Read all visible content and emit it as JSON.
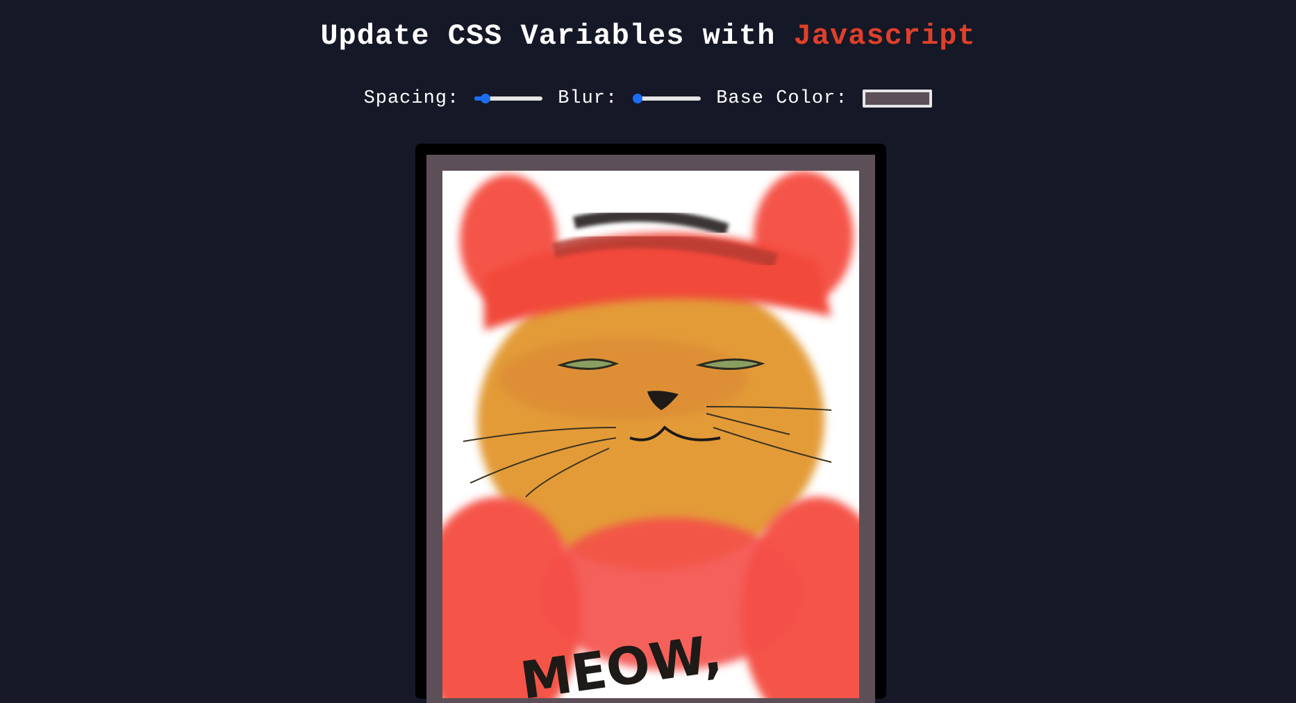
{
  "header": {
    "title_prefix": "Update CSS Variables with ",
    "title_highlight": "Javascript"
  },
  "controls": {
    "spacing_label": "Spacing:",
    "spacing_value": 0.1,
    "blur_label": "Blur:",
    "blur_value": 0.0,
    "base_color_label": "Base Color:",
    "base_color_value": "#5c4f58"
  },
  "colors": {
    "background": "#151826",
    "accent": "#e0402a",
    "slider": "#1a6ef5",
    "frame": "#000000",
    "mat": "#5c4f58"
  },
  "artwork": {
    "text": "MEOW,"
  }
}
